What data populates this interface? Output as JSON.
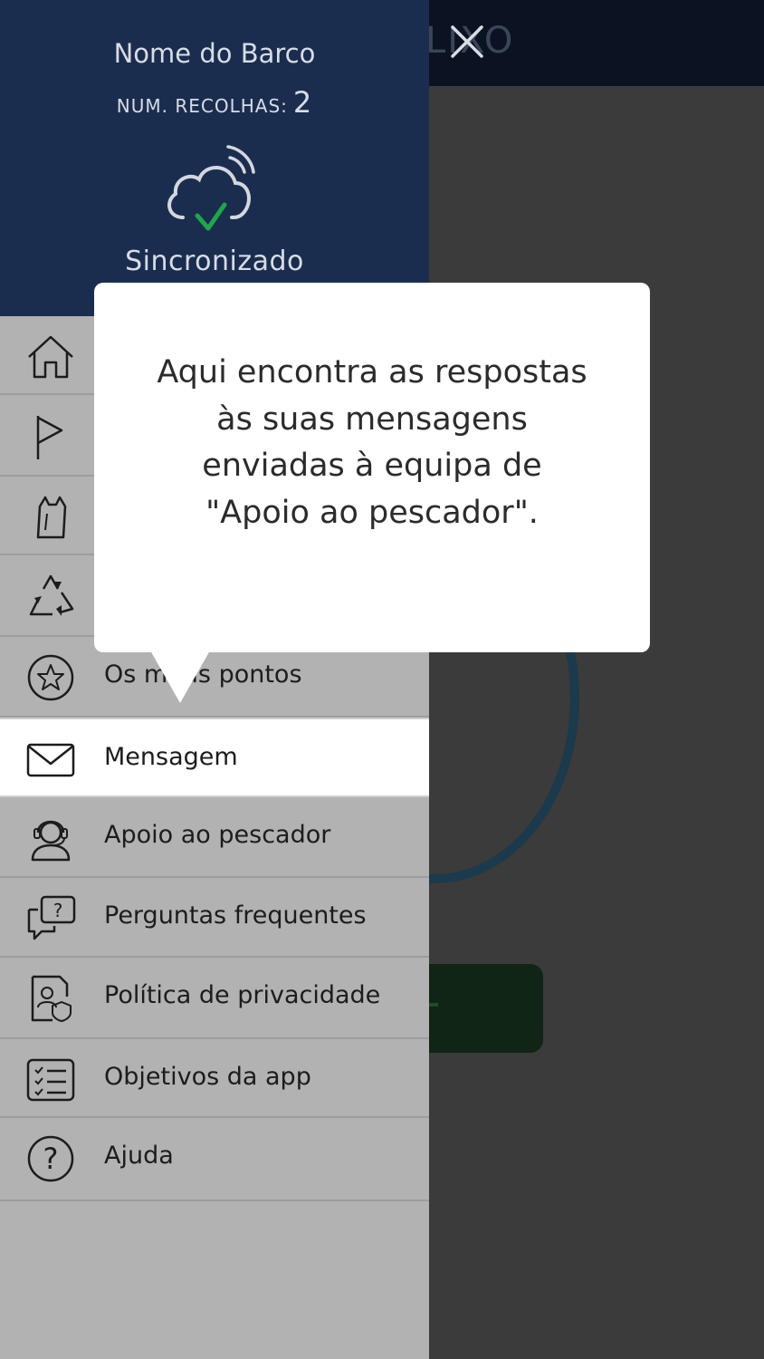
{
  "background": {
    "title_fragment": "LIXO",
    "close_icon": "close-icon"
  },
  "drawer": {
    "boat_name": "Nome do Barco",
    "collections_label": "NUM. RECOLHAS:",
    "collections_count": "2",
    "sync_icon": "cloud-synced-icon",
    "sync_status": "Sincronizado",
    "sync_color": "#1fa64a"
  },
  "menu": {
    "items": [
      {
        "label": "",
        "icon": "home-icon"
      },
      {
        "label": "",
        "icon": "flag-icon"
      },
      {
        "label": "",
        "icon": "bag-icon"
      },
      {
        "label": "",
        "icon": "recycle-icon"
      },
      {
        "label": "Os meus pontos",
        "icon": "star-icon"
      },
      {
        "label": "Mensagem",
        "icon": "mail-icon",
        "active": true
      },
      {
        "label": "Apoio ao pescador",
        "icon": "headset-icon"
      },
      {
        "label": "Perguntas frequentes",
        "icon": "faq-icon"
      },
      {
        "label": "Política de privacidade",
        "icon": "privacy-document-icon"
      },
      {
        "label": "Objetivos da app",
        "icon": "checklist-icon"
      },
      {
        "label": "Ajuda",
        "icon": "help-icon"
      }
    ]
  },
  "tooltip": {
    "text": "Aqui encontra as respostas às suas mensagens enviadas à equipa de \"Apoio ao pescador\"."
  }
}
